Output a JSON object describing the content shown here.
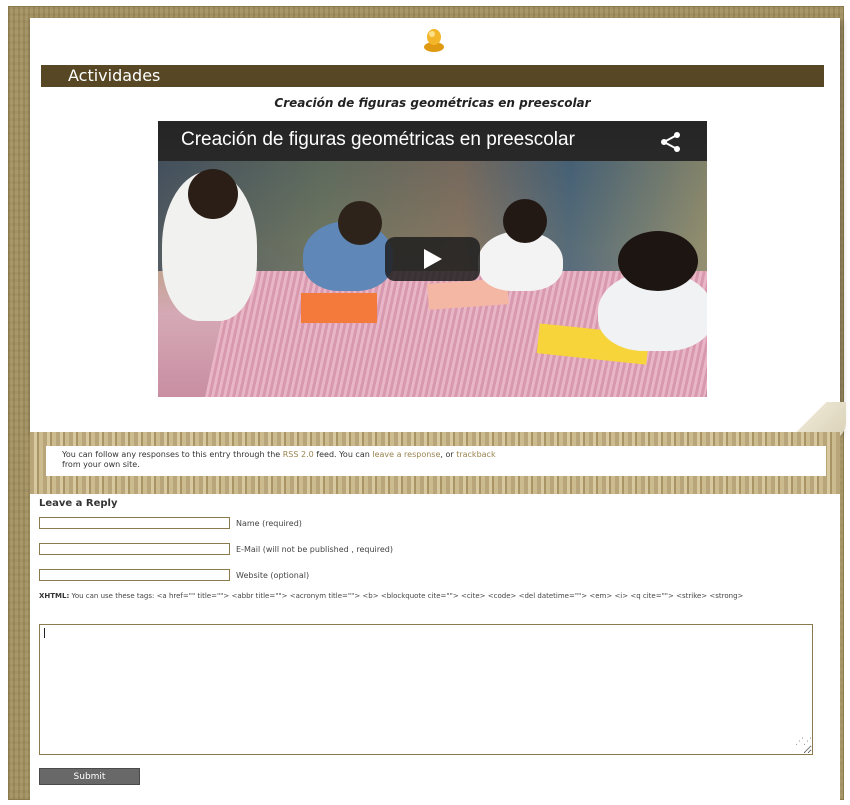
{
  "header": {
    "title": "Actividades"
  },
  "post": {
    "title": "Creación de figuras geométricas en preescolar"
  },
  "video": {
    "title": "Creación de figuras geométricas en preescolar",
    "share_icon": "share-icon",
    "play_icon": "play-icon"
  },
  "notice": {
    "text1": "You can follow any responses to this entry through the ",
    "rss_link": "RSS 2.0",
    "text2": " feed. You can ",
    "leave_link": "leave a response",
    "text3": ", or ",
    "trackback_link": "trackback",
    "text4": " from your own site."
  },
  "reply": {
    "heading": "Leave a Reply",
    "name_label": "Name (required)",
    "email_label": "E-Mail (will not be published , required)",
    "website_label": "Website (optional)",
    "tags_prefix": "XHTML:",
    "tags_text": " You can use these tags: <a href=\"\" title=\"\"> <abbr title=\"\"> <acronym title=\"\"> <b> <blockquote cite=\"\"> <cite> <code> <del datetime=\"\"> <em> <i> <q cite=\"\"> <strike> <strong>",
    "comment_value": "",
    "submit_label": "Submit"
  }
}
